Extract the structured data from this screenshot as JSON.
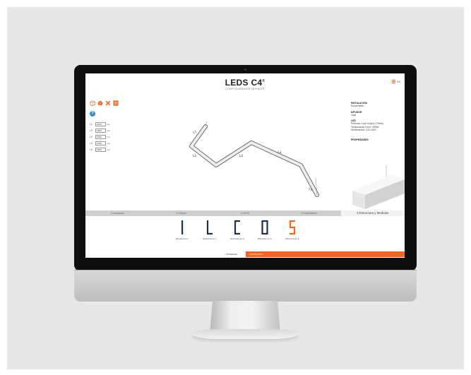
{
  "header": {
    "title": "LEDS C4",
    "trademark": "®",
    "subtitle": "CONFIGURADOR INFINITE",
    "lang": "ES"
  },
  "toolbar": {
    "icons": [
      "cube-outline-icon",
      "cube-orange-icon",
      "close-x-icon",
      "grid-icon"
    ],
    "help": "?"
  },
  "lengths": {
    "unit": "mm",
    "rows": [
      {
        "label": "L1",
        "value": "2400"
      },
      {
        "label": "L2",
        "value": "1800"
      },
      {
        "label": "L3",
        "value": "1200"
      },
      {
        "label": "L4",
        "value": "1200"
      },
      {
        "label": "L5",
        "value": "1800"
      }
    ]
  },
  "scene_labels": [
    "L1",
    "L2",
    "L3",
    "L4",
    "L5"
  ],
  "info": {
    "installation_title": "INSTALACIÓN",
    "installation_value": "Suspendida",
    "diffuser_title": "DIFUSOR",
    "diffuser_value": "Opal",
    "led_title": "LED",
    "led_lines": [
      "Potencia: Low Output (17W/m)",
      "Temperatura Color: 4000K",
      "Alimentación: 220-240V"
    ],
    "properties_title": "PROPIEDADES"
  },
  "tabs": [
    {
      "label": "1 Instalación",
      "active": false
    },
    {
      "label": "2 Difusor",
      "active": false
    },
    {
      "label": "3 LEDS",
      "active": false
    },
    {
      "label": "4 Propiedades",
      "active": false
    },
    {
      "label": "5 Estructura y Medidas",
      "active": true
    }
  ],
  "shapes": [
    {
      "label": "Estructura en I"
    },
    {
      "label": "Estructura en L"
    },
    {
      "label": "Estructura en C"
    },
    {
      "label": "Estructura en O"
    },
    {
      "label": "Estructura en S"
    }
  ],
  "nav": {
    "prev": "< ANTERIOR",
    "next": "CONTINUAR >"
  },
  "colors": {
    "accent": "#f26522",
    "help": "#2d8fd5"
  }
}
